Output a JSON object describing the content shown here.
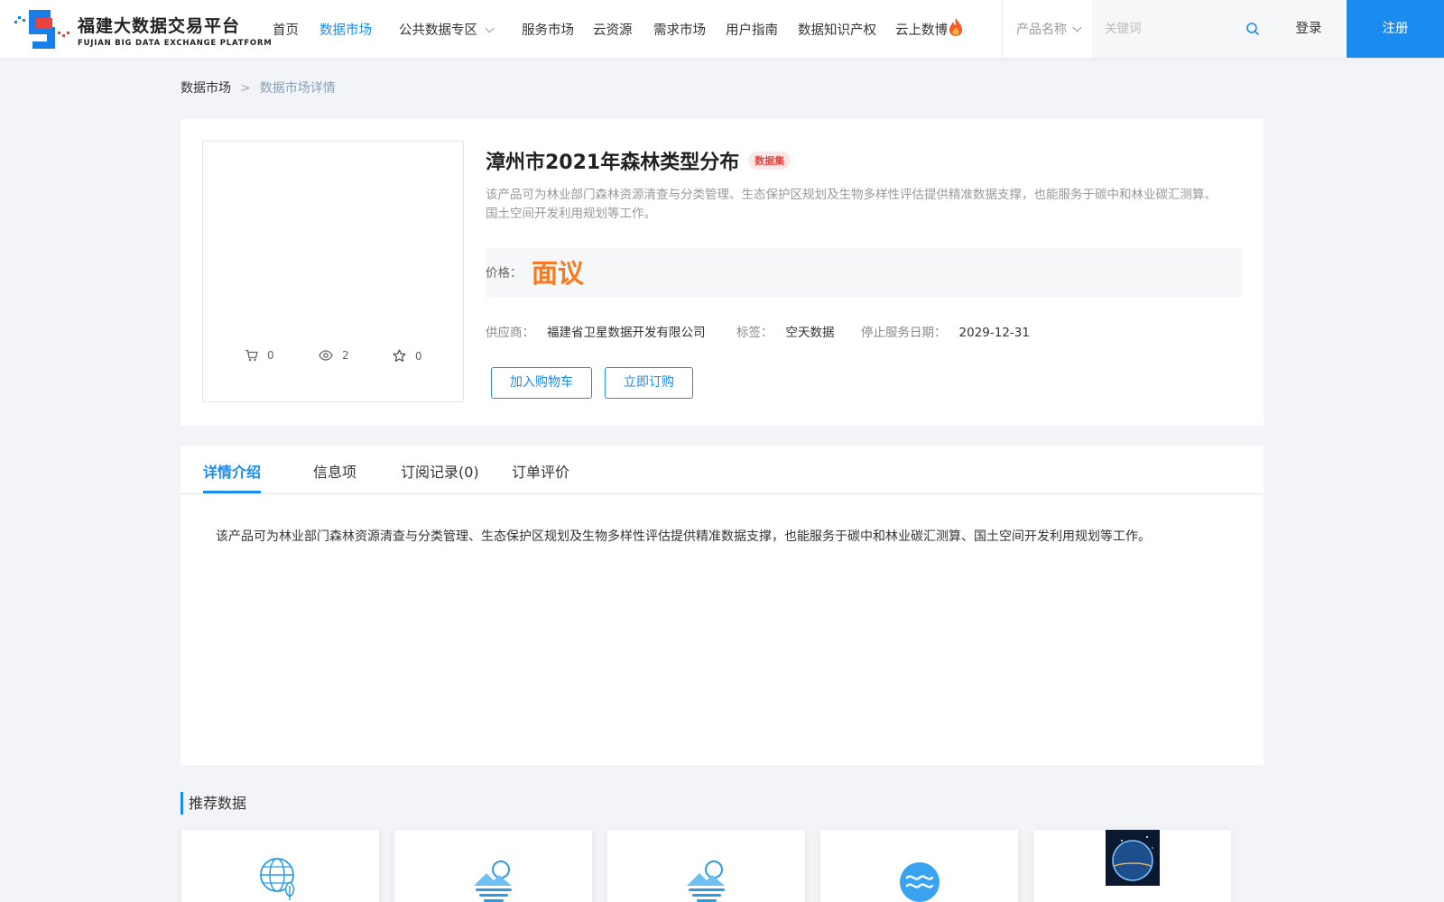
{
  "header": {
    "logo": {
      "cn": "福建大数据交易平台",
      "en": "FUJIAN BIG DATA EXCHANGE  PLATFORM"
    },
    "nav": [
      {
        "label": "首页",
        "active": false
      },
      {
        "label": "数据市场",
        "active": true
      },
      {
        "label": "公共数据专区",
        "active": false,
        "dropdown": true
      },
      {
        "label": "服务市场",
        "active": false
      },
      {
        "label": "云资源",
        "active": false
      },
      {
        "label": "需求市场",
        "active": false
      },
      {
        "label": "用户指南",
        "active": false
      },
      {
        "label": "数据知识产权",
        "active": false
      },
      {
        "label": "云上数博",
        "active": false,
        "icon": "fire-icon"
      }
    ],
    "search": {
      "type_label": "产品名称",
      "placeholder": "关键词",
      "value": ""
    },
    "login_label": "登录",
    "register_label": "注册"
  },
  "breadcrumb": {
    "home": "数据市场",
    "separator": ">",
    "current": "数据市场详情"
  },
  "product": {
    "title": "漳州市2021年森林类型分布",
    "badge": "数据集",
    "summary": "该产品可为林业部门森林资源清查与分类管理、生态保护区规划及生物多样性评估提供精准数据支撑，也能服务于碳中和林业碳汇测算、国土空间开发利用规划等工作。",
    "price_label": "价格：",
    "price_value": "面议",
    "stats": {
      "cart": "0",
      "views": "2",
      "favorites": "0"
    },
    "supplier_label": "供应商：",
    "supplier": "福建省卫星数据开发有限公司",
    "tag_label": "标签：",
    "tag": "空天数据",
    "end_date_label": "停止服务日期：",
    "end_date": "2029-12-31",
    "add_cart_label": "加入购物车",
    "buy_label": "立即订购"
  },
  "tabs": {
    "items": [
      "详情介绍",
      "信息项",
      "订阅记录(0)",
      "订单评价"
    ],
    "active_index": 0,
    "content": "该产品可为林业部门森林资源清查与分类管理、生态保护区规划及生物多样性评估提供精准数据支撑，也能服务于碳中和林业碳汇测算、国土空间开发利用规划等工作。"
  },
  "recommend": {
    "title": "推荐数据",
    "cards": [
      {
        "icon": "globe-leaf-icon"
      },
      {
        "icon": "mountain-sun-icon"
      },
      {
        "icon": "mountain-sun-icon"
      },
      {
        "icon": "water-wave-icon"
      },
      {
        "icon": "satellite-earth-image"
      }
    ]
  },
  "colors": {
    "accent": "#1a8cf0",
    "price": "#f77a22",
    "badge": "#e8433e"
  }
}
